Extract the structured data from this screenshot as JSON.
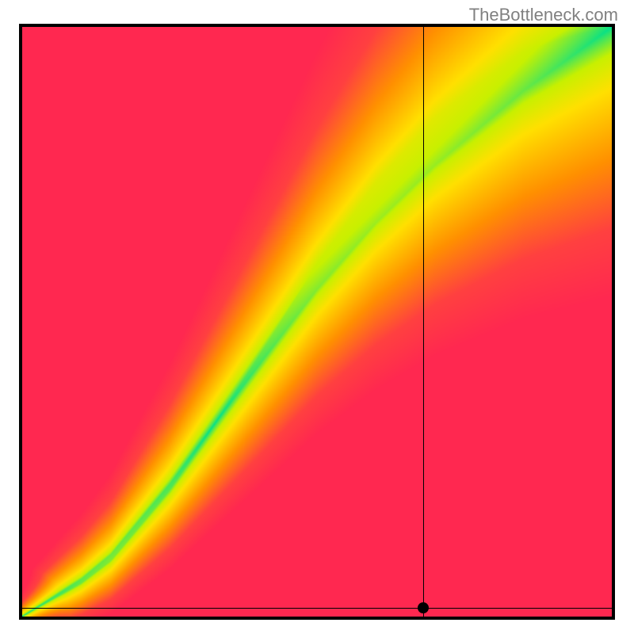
{
  "watermark": "TheBottleneck.com",
  "chart_data": {
    "type": "heatmap",
    "title": "",
    "xlabel": "",
    "ylabel": "",
    "xlim": [
      0,
      100
    ],
    "ylim": [
      0,
      100
    ],
    "crosshair": {
      "x": 68,
      "y": 1.5
    },
    "ridge": [
      {
        "x": 0,
        "y": 0
      },
      {
        "x": 5,
        "y": 3
      },
      {
        "x": 10,
        "y": 6
      },
      {
        "x": 15,
        "y": 10
      },
      {
        "x": 20,
        "y": 16
      },
      {
        "x": 25,
        "y": 22
      },
      {
        "x": 30,
        "y": 29
      },
      {
        "x": 35,
        "y": 36
      },
      {
        "x": 40,
        "y": 43
      },
      {
        "x": 45,
        "y": 50
      },
      {
        "x": 50,
        "y": 57
      },
      {
        "x": 55,
        "y": 63
      },
      {
        "x": 60,
        "y": 69
      },
      {
        "x": 65,
        "y": 74
      },
      {
        "x": 70,
        "y": 79
      },
      {
        "x": 75,
        "y": 83
      },
      {
        "x": 80,
        "y": 87
      },
      {
        "x": 85,
        "y": 91
      },
      {
        "x": 90,
        "y": 94
      },
      {
        "x": 95,
        "y": 97
      },
      {
        "x": 100,
        "y": 100
      }
    ],
    "color_stops": [
      {
        "t": 0.0,
        "color": "#00e08c"
      },
      {
        "t": 0.12,
        "color": "#c8f000"
      },
      {
        "t": 0.25,
        "color": "#ffe000"
      },
      {
        "t": 0.5,
        "color": "#ff9000"
      },
      {
        "t": 0.75,
        "color": "#ff4040"
      },
      {
        "t": 1.0,
        "color": "#ff2850"
      }
    ],
    "legend": []
  }
}
